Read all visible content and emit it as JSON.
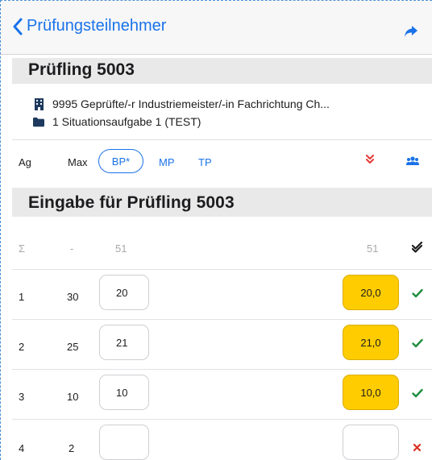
{
  "nav": {
    "back_label": "Prüfungsteilnehmer"
  },
  "header": {
    "title": "Prüfling 5003"
  },
  "info": {
    "course": "9995 Geprüfte/-r Industriemeister/-in  Fachrichtung Ch...",
    "task": "1 Situationsaufgabe 1 (TEST)"
  },
  "filters": {
    "ag": "Ag",
    "max": "Max",
    "bp": "BP*",
    "mp": "MP",
    "tp": "TP"
  },
  "entry_section": {
    "prefix": "Eingabe für Prüfling ",
    "id": "5003"
  },
  "sum_row": {
    "sigma": "Σ",
    "dash": "-",
    "total": "51",
    "result": "51"
  },
  "rows": [
    {
      "ag": "1",
      "max": "30",
      "score": "20",
      "result": "20,0",
      "status": "ok"
    },
    {
      "ag": "2",
      "max": "25",
      "score": "21",
      "result": "21,0",
      "status": "ok"
    },
    {
      "ag": "3",
      "max": "10",
      "score": "10",
      "result": "10,0",
      "status": "ok"
    },
    {
      "ag": "4",
      "max": "2",
      "score": "",
      "result": "",
      "status": "error"
    }
  ],
  "colors": {
    "accent": "#1a73e8",
    "highlight": "#ffcc00",
    "ok": "#1e8e3e",
    "error": "#d93025"
  }
}
